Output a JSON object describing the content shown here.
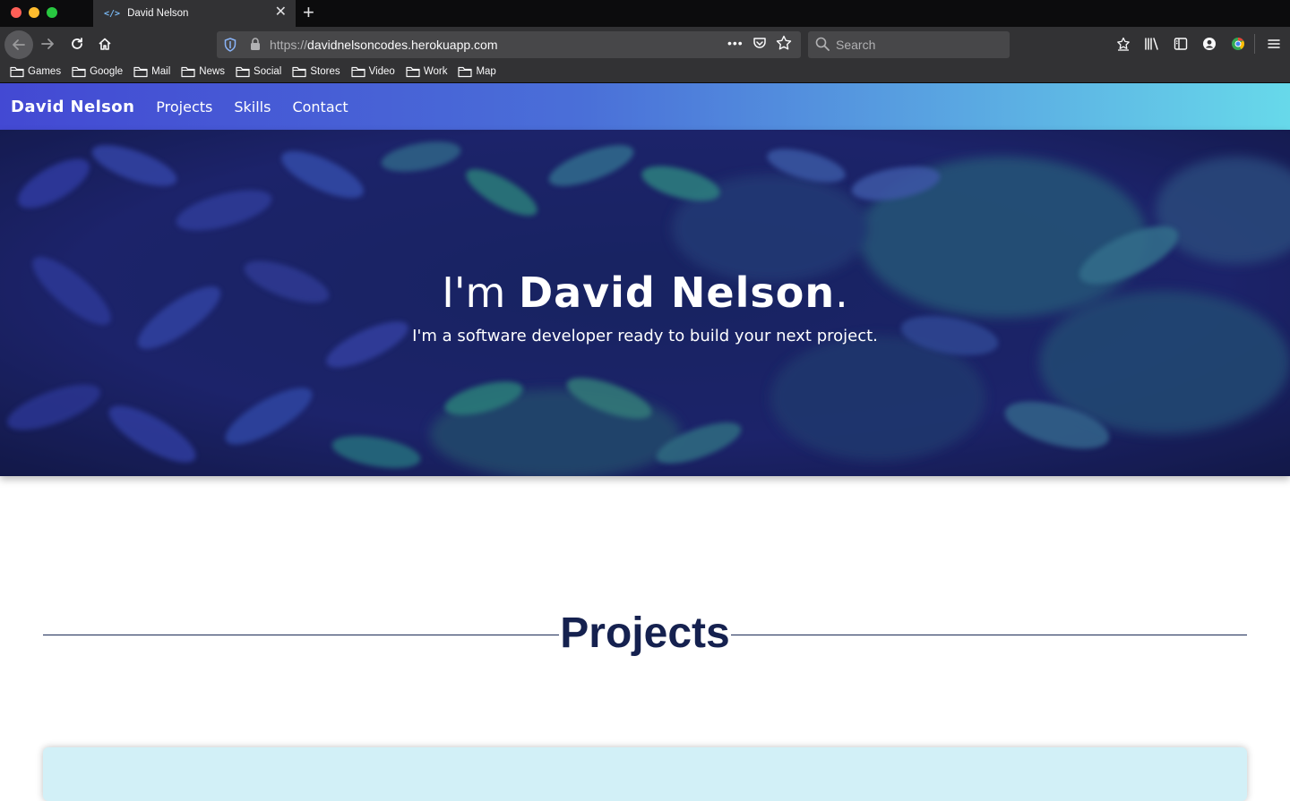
{
  "browser": {
    "tab": {
      "title": "David Nelson",
      "icon": "code-icon"
    },
    "url": {
      "scheme": "https://",
      "host": "davidnelsoncodes.herokuapp.com"
    },
    "search_placeholder": "Search",
    "bookmarks": [
      "Games",
      "Google",
      "Mail",
      "News",
      "Social",
      "Stores",
      "Video",
      "Work",
      "Map"
    ]
  },
  "site": {
    "brand": "David Nelson",
    "nav": [
      "Projects",
      "Skills",
      "Contact"
    ],
    "hero": {
      "title_prefix": "I'm ",
      "title_name": "David Nelson",
      "title_suffix": ".",
      "subtitle": "I'm a software developer ready to build your next project."
    },
    "section_title": "Projects",
    "colors": {
      "nav_gradient_start": "#4349d3",
      "nav_gradient_end": "#67d9ea",
      "section_title": "#15214f",
      "card_bg": "#d2f0f7"
    }
  }
}
